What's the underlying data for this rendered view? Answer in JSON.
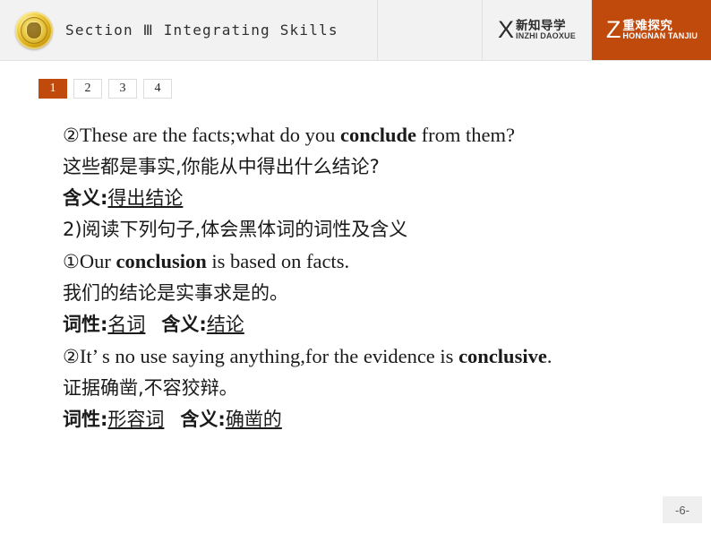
{
  "header": {
    "emblem_icon": "gold-seal-emblem-icon",
    "title": "Section Ⅲ  Integrating Skills",
    "tabs": [
      {
        "letter": "X",
        "cn": "新知导学",
        "en": "INZHI DAOXUE",
        "active": false
      },
      {
        "letter": "Z",
        "cn": "重难探究",
        "en": "HONGNAN TANJIU",
        "active": true
      }
    ]
  },
  "number_tabs": [
    {
      "label": "1"
    },
    {
      "label": "2"
    },
    {
      "label": "3"
    },
    {
      "label": "4"
    }
  ],
  "content": {
    "l1_marker": "②",
    "l1_a": "These are the facts;what do you ",
    "l1_bold": "conclude",
    "l1_b": " from them?",
    "l2": "这些都是事实,你能从中得出什么结论?",
    "l3_label": "含义:",
    "l3_value": "得出结论",
    "l4": "2)阅读下列句子,体会黑体词的词性及含义",
    "l5_marker": "①",
    "l5_a": "Our ",
    "l5_bold": "conclusion",
    "l5_b": " is based on facts.",
    "l6": "我们的结论是实事求是的。",
    "l7_label1": "词性:",
    "l7_value1": "名词",
    "l7_label2": "含义:",
    "l7_value2": "结论",
    "l8_marker": "②",
    "l8_a": "It’ s no use saying anything,for the evidence is ",
    "l8_bold": "conclusive",
    "l8_b": ".",
    "l9": "证据确凿,不容狡辩。",
    "l10_label1": "词性:",
    "l10_value1": "形容词",
    "l10_label2": "含义:",
    "l10_value2": "确凿的"
  },
  "footer": {
    "page_label": "-6-"
  },
  "colors": {
    "accent": "#bf4a0c",
    "header_bg": "#f2f2f2",
    "page_bg": "#ffffff",
    "text": "#1a1a1a"
  }
}
